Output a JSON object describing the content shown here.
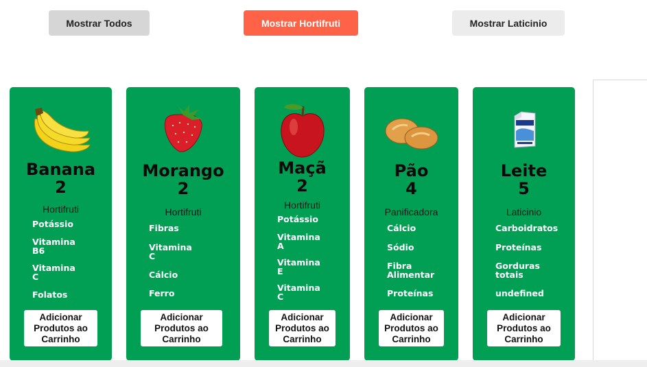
{
  "filters": {
    "todos": "Mostrar Todos",
    "hortifruti": "Mostrar Hortifruti",
    "laticinio": "Mostrar Laticinio"
  },
  "colors": {
    "card": "#009f53",
    "active_filter": "#ff6347"
  },
  "products": [
    {
      "name": "Banana",
      "qty": "2",
      "category": "Hortifruti",
      "icon": "banana-icon",
      "nutrients": [
        "Potássio",
        "Vitamina\nB6",
        "Vitamina\nC",
        "Folatos"
      ],
      "button": "Adicionar\nProdutos ao\nCarrinho"
    },
    {
      "name": "Morango",
      "qty": "2",
      "category": "Hortifruti",
      "icon": "strawberry-icon",
      "nutrients": [
        "Fibras",
        "Vitamina\nC",
        "Cálcio",
        "Ferro"
      ],
      "button": "Adicionar\nProdutos ao\nCarrinho"
    },
    {
      "name": "Maçã",
      "qty": "2",
      "category": "Hortifruti",
      "icon": "apple-icon",
      "nutrients": [
        "Potássio",
        "Vitamina\nA",
        "Vitamina\nE",
        "Vitamina\nC"
      ],
      "button": "Adicionar\nProdutos ao\nCarrinho"
    },
    {
      "name": "Pão",
      "qty": "4",
      "category": "Panificadora",
      "icon": "bread-icon",
      "nutrients": [
        "Cálcio",
        "Sódio",
        "Fibra\nAlimentar",
        "Proteínas"
      ],
      "button": "Adicionar\nProdutos ao\nCarrinho"
    },
    {
      "name": "Leite",
      "qty": "5",
      "category": "Laticinio",
      "icon": "milk-carton-icon",
      "nutrients": [
        "Carboidratos",
        "Proteínas",
        "Gorduras\ntotais",
        "undefined"
      ],
      "button": "Adicionar\nProdutos ao\nCarrinho"
    }
  ]
}
